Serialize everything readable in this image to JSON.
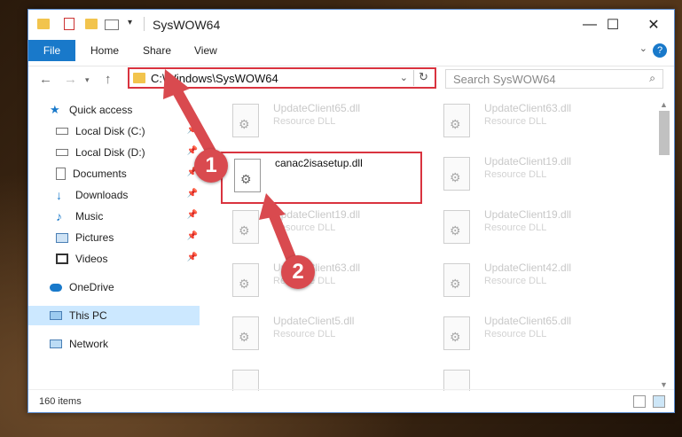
{
  "window": {
    "title": "SysWOW64",
    "minimize": "—",
    "maximize": "☐",
    "close": "✕"
  },
  "ribbon": {
    "file": "File",
    "tabs": [
      "Home",
      "Share",
      "View"
    ],
    "help": "?"
  },
  "nav": {
    "address_path": "C:\\Windows\\SysWOW64",
    "search_placeholder": "Search SysWOW64"
  },
  "sidebar": {
    "items": [
      {
        "label": "Quick access",
        "icon": "star-icon"
      },
      {
        "label": "Local Disk (C:)",
        "icon": "drive-icon"
      },
      {
        "label": "Local Disk (D:)",
        "icon": "drive-icon"
      },
      {
        "label": "Documents",
        "icon": "documents-icon"
      },
      {
        "label": "Downloads",
        "icon": "downloads-icon"
      },
      {
        "label": "Music",
        "icon": "music-icon"
      },
      {
        "label": "Pictures",
        "icon": "pictures-icon"
      },
      {
        "label": "Videos",
        "icon": "videos-icon"
      },
      {
        "label": "OneDrive",
        "icon": "cloud-icon"
      },
      {
        "label": "This PC",
        "icon": "computer-icon"
      },
      {
        "label": "Network",
        "icon": "network-icon"
      }
    ]
  },
  "files": [
    {
      "name": "UpdateClient65.dll",
      "type": "Resource DLL"
    },
    {
      "name": "UpdateClient63.dll",
      "type": "Resource DLL"
    },
    {
      "name": "canac2isasetup.dll",
      "type": ""
    },
    {
      "name": "UpdateClient19.dll",
      "type": "Resource DLL"
    },
    {
      "name": "UpdateClient19.dll",
      "type": "Resource DLL"
    },
    {
      "name": "UpdateClient19.dll",
      "type": "Resource DLL"
    },
    {
      "name": "UpdateClient63.dll",
      "type": "Resource DLL"
    },
    {
      "name": "UpdateClient42.dll",
      "type": "Resource DLL"
    },
    {
      "name": "UpdateClient5.dll",
      "type": "Resource DLL"
    },
    {
      "name": "UpdateClient65.dll",
      "type": "Resource DLL"
    }
  ],
  "status": {
    "item_count": "160 items"
  },
  "callouts": [
    "1",
    "2"
  ],
  "colors": {
    "accent": "#1979ca",
    "highlight": "#d9333f",
    "callout": "#d94a4f"
  }
}
